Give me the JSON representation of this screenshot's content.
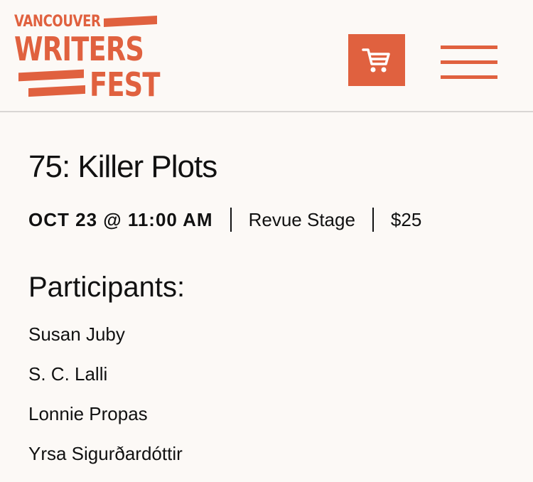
{
  "logo": {
    "line1": "VANCOUVER",
    "line2": "WRITERS",
    "line3": "FEST"
  },
  "header": {
    "cart_icon": "shopping-cart-icon",
    "menu_icon": "hamburger-menu-icon",
    "accent_color": "#e0613f"
  },
  "event": {
    "title": "75: Killer Plots",
    "datetime": "OCT 23 @ 11:00 AM",
    "venue": "Revue Stage",
    "price": "$25"
  },
  "participants": {
    "heading": "Participants:",
    "names": [
      "Susan Juby",
      "S. C. Lalli",
      "Lonnie Propas",
      "Yrsa Sigurðardóttir"
    ]
  }
}
